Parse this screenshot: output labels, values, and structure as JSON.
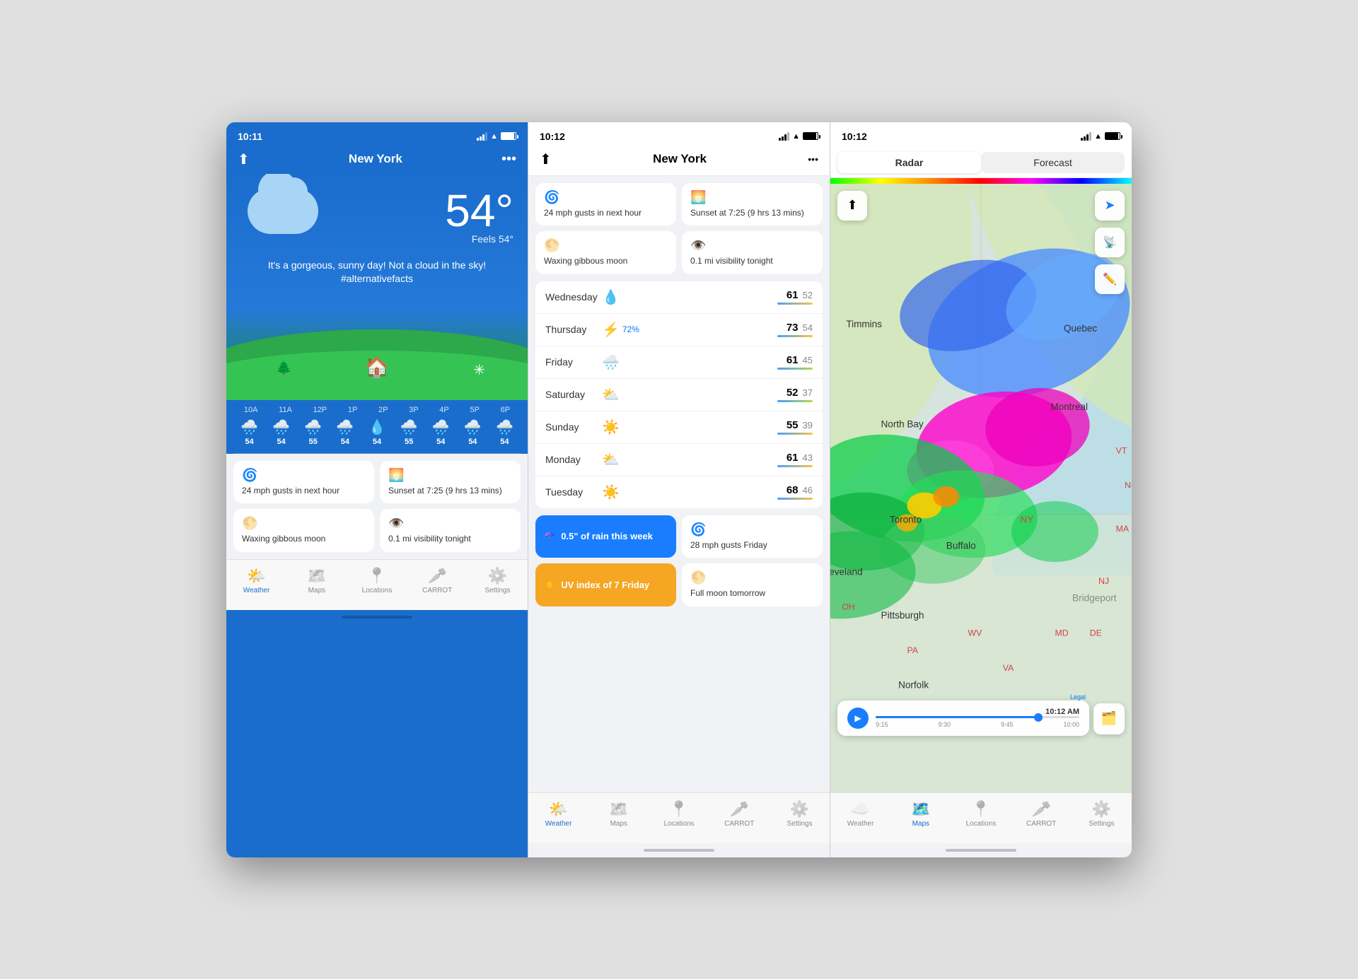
{
  "screens": [
    {
      "id": "screen1",
      "statusBar": {
        "time": "10:11",
        "theme": "dark"
      },
      "header": {
        "title": "New York"
      },
      "weather": {
        "temp": "54°",
        "feelsLike": "Feels 54°",
        "description": "It's a gorgeous, sunny day! Not a cloud in the sky! #alternativefacts",
        "hourlyLabels": [
          "10A",
          "11A",
          "12P",
          "1P",
          "2P",
          "3P",
          "4P",
          "5P",
          "6P"
        ],
        "hourlyTemps": [
          "54",
          "54",
          "55",
          "54",
          "54",
          "55",
          "54",
          "54",
          "54"
        ],
        "hourlyIcons": [
          "🌧️",
          "🌧️",
          "🌧️",
          "🌧️",
          "💧",
          "🌧️",
          "🌧️",
          "🌧️",
          "🌧️"
        ]
      },
      "infoCards": [
        {
          "icon": "🌀",
          "iconColor": "#2ecc71",
          "text": "24 mph gusts in next hour"
        },
        {
          "icon": "🌅",
          "iconColor": "#f39c12",
          "text": "Sunset at 7:25 (9 hrs 13 mins)"
        },
        {
          "icon": "🌕",
          "iconColor": "#e74c3c",
          "text": "Waxing gibbous moon"
        },
        {
          "icon": "👁️",
          "iconColor": "#3498db",
          "text": "0.1 mi visibility tonight"
        }
      ],
      "tabs": [
        {
          "icon": "🌤️",
          "label": "Weather",
          "active": true
        },
        {
          "icon": "🗺️",
          "label": "Maps",
          "active": false
        },
        {
          "icon": "📍",
          "label": "Locations",
          "active": false
        },
        {
          "icon": "🥕",
          "label": "CARROT",
          "active": false
        },
        {
          "icon": "⚙️",
          "label": "Settings",
          "active": false
        }
      ]
    },
    {
      "id": "screen2",
      "statusBar": {
        "time": "10:12",
        "theme": "light"
      },
      "header": {
        "title": "New York"
      },
      "topCards": [
        {
          "icon": "🌀",
          "iconColor": "#2ecc71",
          "text": "24 mph gusts in next hour"
        },
        {
          "icon": "🌅",
          "iconColor": "#f39c12",
          "text": "Sunset at 7:25 (9 hrs 13 mins)"
        },
        {
          "icon": "🌕",
          "iconColor": "#e74c3c",
          "text": "Waxing gibbous moon"
        },
        {
          "icon": "👁️",
          "iconColor": "#3498db",
          "text": "0.1 mi visibility tonight"
        }
      ],
      "forecast": [
        {
          "day": "Wednesday",
          "icon": "💧",
          "precip": "",
          "high": "61",
          "low": "52",
          "barColor": "#f5d020"
        },
        {
          "day": "Thursday",
          "icon": "⚡",
          "precip": "72%",
          "high": "73",
          "low": "54",
          "barColor": "#f5d020"
        },
        {
          "day": "Friday",
          "icon": "🌧️",
          "precip": "",
          "high": "61",
          "low": "45",
          "barColor": "#b8e04a"
        },
        {
          "day": "Saturday",
          "icon": "⛅",
          "precip": "",
          "high": "52",
          "low": "37",
          "barColor": "#b8e04a"
        },
        {
          "day": "Sunday",
          "icon": "☀️",
          "precip": "",
          "high": "55",
          "low": "39",
          "barColor": "#f5d020"
        },
        {
          "day": "Monday",
          "icon": "⛅",
          "precip": "",
          "high": "61",
          "low": "43",
          "barColor": "#f5d020"
        },
        {
          "day": "Tuesday",
          "icon": "☀️",
          "precip": "",
          "high": "68",
          "low": "46",
          "barColor": "#f5d020"
        }
      ],
      "actionCards": [
        {
          "icon": "☂️",
          "text": "0.5\" of rain this week",
          "color": "blue"
        },
        {
          "icon": "🌀",
          "text": "28 mph gusts Friday",
          "color": "white"
        },
        {
          "icon": "☀️",
          "text": "UV index of 7 Friday",
          "color": "orange"
        },
        {
          "icon": "🌕",
          "text": "Full moon tomorrow",
          "color": "white"
        }
      ],
      "tabs": [
        {
          "icon": "🌤️",
          "label": "Weather",
          "active": true
        },
        {
          "icon": "🗺️",
          "label": "Maps",
          "active": false
        },
        {
          "icon": "📍",
          "label": "Locations",
          "active": false
        },
        {
          "icon": "🥕",
          "label": "CARROT",
          "active": false
        },
        {
          "icon": "⚙️",
          "label": "Settings",
          "active": false
        }
      ]
    },
    {
      "id": "screen3",
      "statusBar": {
        "time": "10:12",
        "theme": "light"
      },
      "radarTabs": [
        {
          "label": "Radar",
          "active": true
        },
        {
          "label": "Forecast",
          "active": false
        }
      ],
      "mapLabels": [
        "Timmins",
        "North Bay",
        "Quebec",
        "Montreal",
        "Toronto",
        "Buffalo",
        "Cleveland",
        "Pittsburgh",
        "Norfolk",
        "Bridgeport"
      ],
      "timeline": {
        "times": [
          "9:15",
          "9:30",
          "9:45",
          "10:00"
        ],
        "current": "10:12 AM",
        "fillPercent": 80
      },
      "tabs": [
        {
          "icon": "☁️",
          "label": "Weather",
          "active": false
        },
        {
          "icon": "🗺️",
          "label": "Maps",
          "active": true
        },
        {
          "icon": "📍",
          "label": "Locations",
          "active": false
        },
        {
          "icon": "🥕",
          "label": "CARROT",
          "active": false
        },
        {
          "icon": "⚙️",
          "label": "Settings",
          "active": false
        }
      ]
    }
  ]
}
